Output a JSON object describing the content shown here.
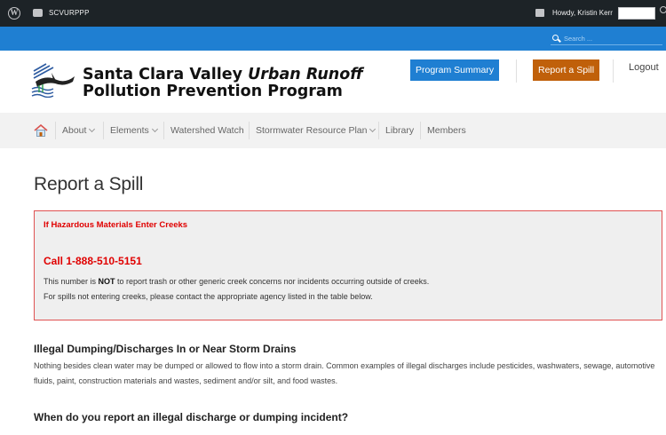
{
  "admin_bar": {
    "site_name": "SCVURPPP",
    "howdy": "Howdy, Kristin Kerr"
  },
  "search": {
    "placeholder": "Search ..."
  },
  "header": {
    "title_line1_plain": "Santa Clara Valley ",
    "title_line1_italic": "Urban Runoff",
    "title_line2": "Pollution Prevention Program",
    "program_summary_label": "Program Summary",
    "report_spill_label": "Report a Spill",
    "logout_label": "Logout"
  },
  "nav": {
    "items": [
      {
        "label": "About",
        "has_dropdown": true
      },
      {
        "label": "Elements",
        "has_dropdown": true
      },
      {
        "label": "Watershed Watch",
        "has_dropdown": false
      },
      {
        "label": "Stormwater Resource Plan",
        "has_dropdown": true
      },
      {
        "label": "Library",
        "has_dropdown": false
      },
      {
        "label": "Members",
        "has_dropdown": false
      }
    ]
  },
  "content": {
    "page_title": "Report a Spill",
    "alert": {
      "heading": "If Hazardous Materials Enter Creeks",
      "call": "Call 1-888-510-5151",
      "line1_pre": "This number is ",
      "line1_bold": "NOT",
      "line1_post": " to report trash or other generic creek concerns nor incidents occurring outside of creeks.",
      "line2": "For spills not entering creeks, please contact the appropriate agency listed in the table below."
    },
    "section1_heading": "Illegal Dumping/Discharges In or Near Storm Drains",
    "section1_text": "Nothing besides clean water may be dumped or allowed to flow into a storm drain. Common examples of illegal discharges include pesticides, washwaters, sewage, automotive fluids, paint, construction materials and wastes, sediment and/or silt, and food wastes.",
    "section2_heading": "When do you report an illegal discharge or dumping incident?"
  },
  "colors": {
    "admin_bar": "#1d2327",
    "blue_bar": "#1f7fd2",
    "report_button": "#c0600a",
    "alert_red": "#e00000"
  },
  "icons": [
    "wordpress-icon",
    "site-icon",
    "comment-icon",
    "search-icon",
    "home-icon",
    "logo-icon"
  ]
}
